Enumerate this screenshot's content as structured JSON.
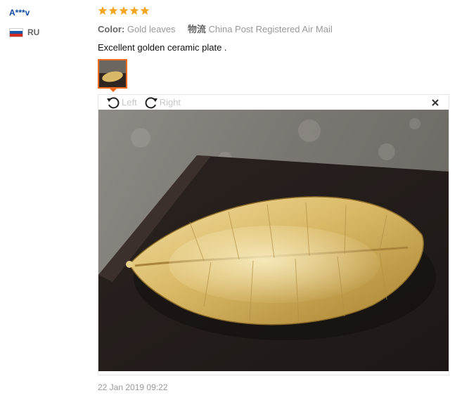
{
  "reviewer": {
    "name": "A***v",
    "country_code": "RU",
    "flag_colors": [
      "#ffffff",
      "#1c57a5",
      "#d52b1e"
    ]
  },
  "review": {
    "rating": 5,
    "star_color": "#f5a623",
    "color_label": "Color:",
    "color_value": "Gold leaves",
    "shipping_label": "物流",
    "shipping_value": "China Post Registered Air Mail",
    "text": "Excellent golden ceramic plate .",
    "date": "22 Jan 2019 09:22"
  },
  "viewer": {
    "rotate_left_label": "Left",
    "rotate_right_label": "Right",
    "close_icon": "close-icon",
    "image_icon": "gold-leaf-plate-photo"
  },
  "colors": {
    "accent": "#f26b1d",
    "username": "#0f4aa3"
  }
}
